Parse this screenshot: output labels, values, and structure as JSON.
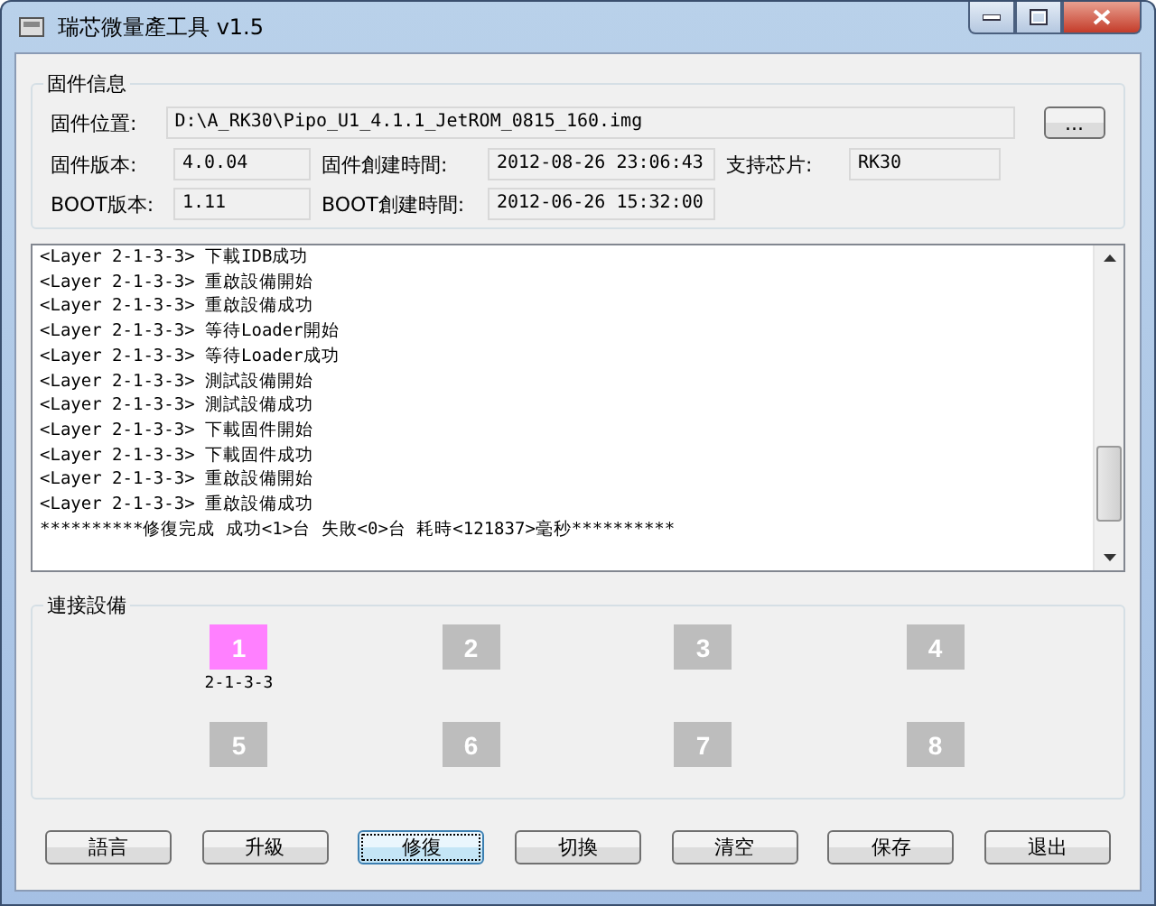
{
  "window": {
    "title": "瑞芯微量產工具 v1.5"
  },
  "firmware_info": {
    "title": "固件信息",
    "path": {
      "label": "固件位置:",
      "value": "D:\\A_RK30\\Pipo_U1_4.1.1_JetROM_0815_160.img"
    },
    "browse_button": "...",
    "fields": [
      {
        "label": "固件版本:",
        "value": "4.0.04"
      },
      {
        "label": "固件創建時間:",
        "value": "2012-08-26 23:06:43"
      },
      {
        "label": "支持芯片:",
        "value": "RK30"
      },
      {
        "label": "BOOT版本:",
        "value": "1.11"
      },
      {
        "label": "BOOT創建時間:",
        "value": "2012-06-26 15:32:00"
      }
    ]
  },
  "log": [
    "<Layer 2-1-3-3> 下載IDB成功",
    "<Layer 2-1-3-3> 重啟設備開始",
    "<Layer 2-1-3-3> 重啟設備成功",
    "<Layer 2-1-3-3> 等待Loader開始",
    "<Layer 2-1-3-3> 等待Loader成功",
    "<Layer 2-1-3-3> 測試設備開始",
    "<Layer 2-1-3-3> 測試設備成功",
    "<Layer 2-1-3-3> 下載固件開始",
    "<Layer 2-1-3-3> 下載固件成功",
    "<Layer 2-1-3-3> 重啟設備開始",
    "<Layer 2-1-3-3> 重啟設備成功",
    "**********修復完成 成功<1>台 失敗<0>台 耗時<121837>毫秒**********"
  ],
  "devices": {
    "title": "連接設備",
    "slots": [
      {
        "number": "1",
        "connected": true,
        "port": "2-1-3-3"
      },
      {
        "number": "2",
        "connected": false
      },
      {
        "number": "3",
        "connected": false
      },
      {
        "number": "4",
        "connected": false
      },
      {
        "number": "5",
        "connected": false
      },
      {
        "number": "6",
        "connected": false
      },
      {
        "number": "7",
        "connected": false
      },
      {
        "number": "8",
        "connected": false
      }
    ]
  },
  "buttons": [
    {
      "label": "語言",
      "focused": false
    },
    {
      "label": "升級",
      "focused": false
    },
    {
      "label": "修復",
      "focused": true
    },
    {
      "label": "切換",
      "focused": false
    },
    {
      "label": "清空",
      "focused": false
    },
    {
      "label": "保存",
      "focused": false
    },
    {
      "label": "退出",
      "focused": false
    }
  ]
}
